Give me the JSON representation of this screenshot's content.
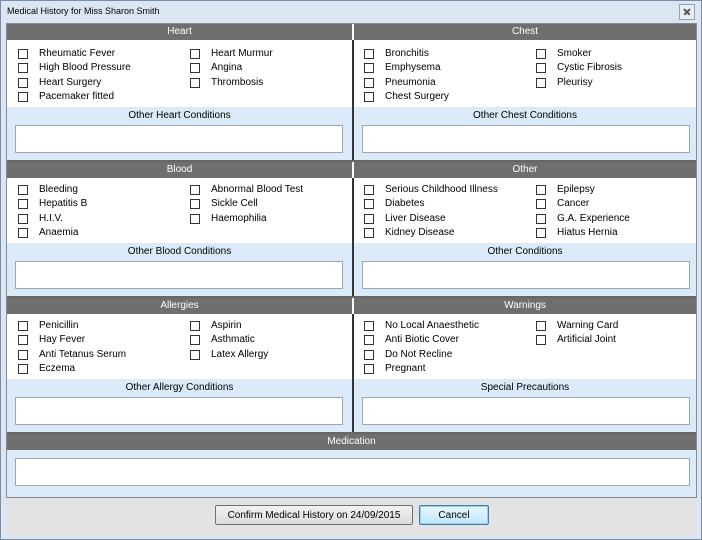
{
  "window": {
    "title": "Medical History for Miss Sharon Smith"
  },
  "heart": {
    "header": "Heart",
    "left": [
      "Rheumatic Fever",
      "High Blood Pressure",
      "Heart Surgery",
      "Pacemaker fitted"
    ],
    "right": [
      "Heart Murmur",
      "Angina",
      "Thrombosis"
    ],
    "other_label": "Other Heart Conditions"
  },
  "chest": {
    "header": "Chest",
    "left": [
      "Bronchitis",
      "Emphysema",
      "Pneumonia",
      "Chest Surgery"
    ],
    "right": [
      "Smoker",
      "Cystic Fibrosis",
      "Pleurisy"
    ],
    "other_label": "Other Chest Conditions"
  },
  "blood": {
    "header": "Blood",
    "left": [
      "Bleeding",
      "Hepatitis B",
      "H.I.V.",
      "Anaemia"
    ],
    "right": [
      "Abnormal Blood Test",
      "Sickle Cell",
      "Haemophilia"
    ],
    "other_label": "Other Blood Conditions"
  },
  "other": {
    "header": "Other",
    "left": [
      "Serious Childhood Illness",
      "Diabetes",
      "Liver Disease",
      "Kidney Disease"
    ],
    "right": [
      "Epilepsy",
      "Cancer",
      "G.A. Experience",
      "Hiatus Hernia"
    ],
    "other_label": "Other Conditions"
  },
  "allergies": {
    "header": "Allergies",
    "left": [
      "Penicillin",
      "Hay Fever",
      "Anti Tetanus Serum",
      "Eczema"
    ],
    "right": [
      "Aspirin",
      "Asthmatic",
      "Latex Allergy"
    ],
    "other_label": "Other Allergy Conditions"
  },
  "warnings": {
    "header": "Warnings",
    "left": [
      "No Local Anaesthetic",
      "Anti Biotic Cover",
      "Do Not Recline",
      "Pregnant"
    ],
    "right": [
      "Warning Card",
      "Artificial Joint"
    ],
    "other_label": "Special Precautions"
  },
  "medication": {
    "header": "Medication"
  },
  "buttons": {
    "confirm": "Confirm Medical History on 24/09/2015",
    "cancel": "Cancel"
  }
}
